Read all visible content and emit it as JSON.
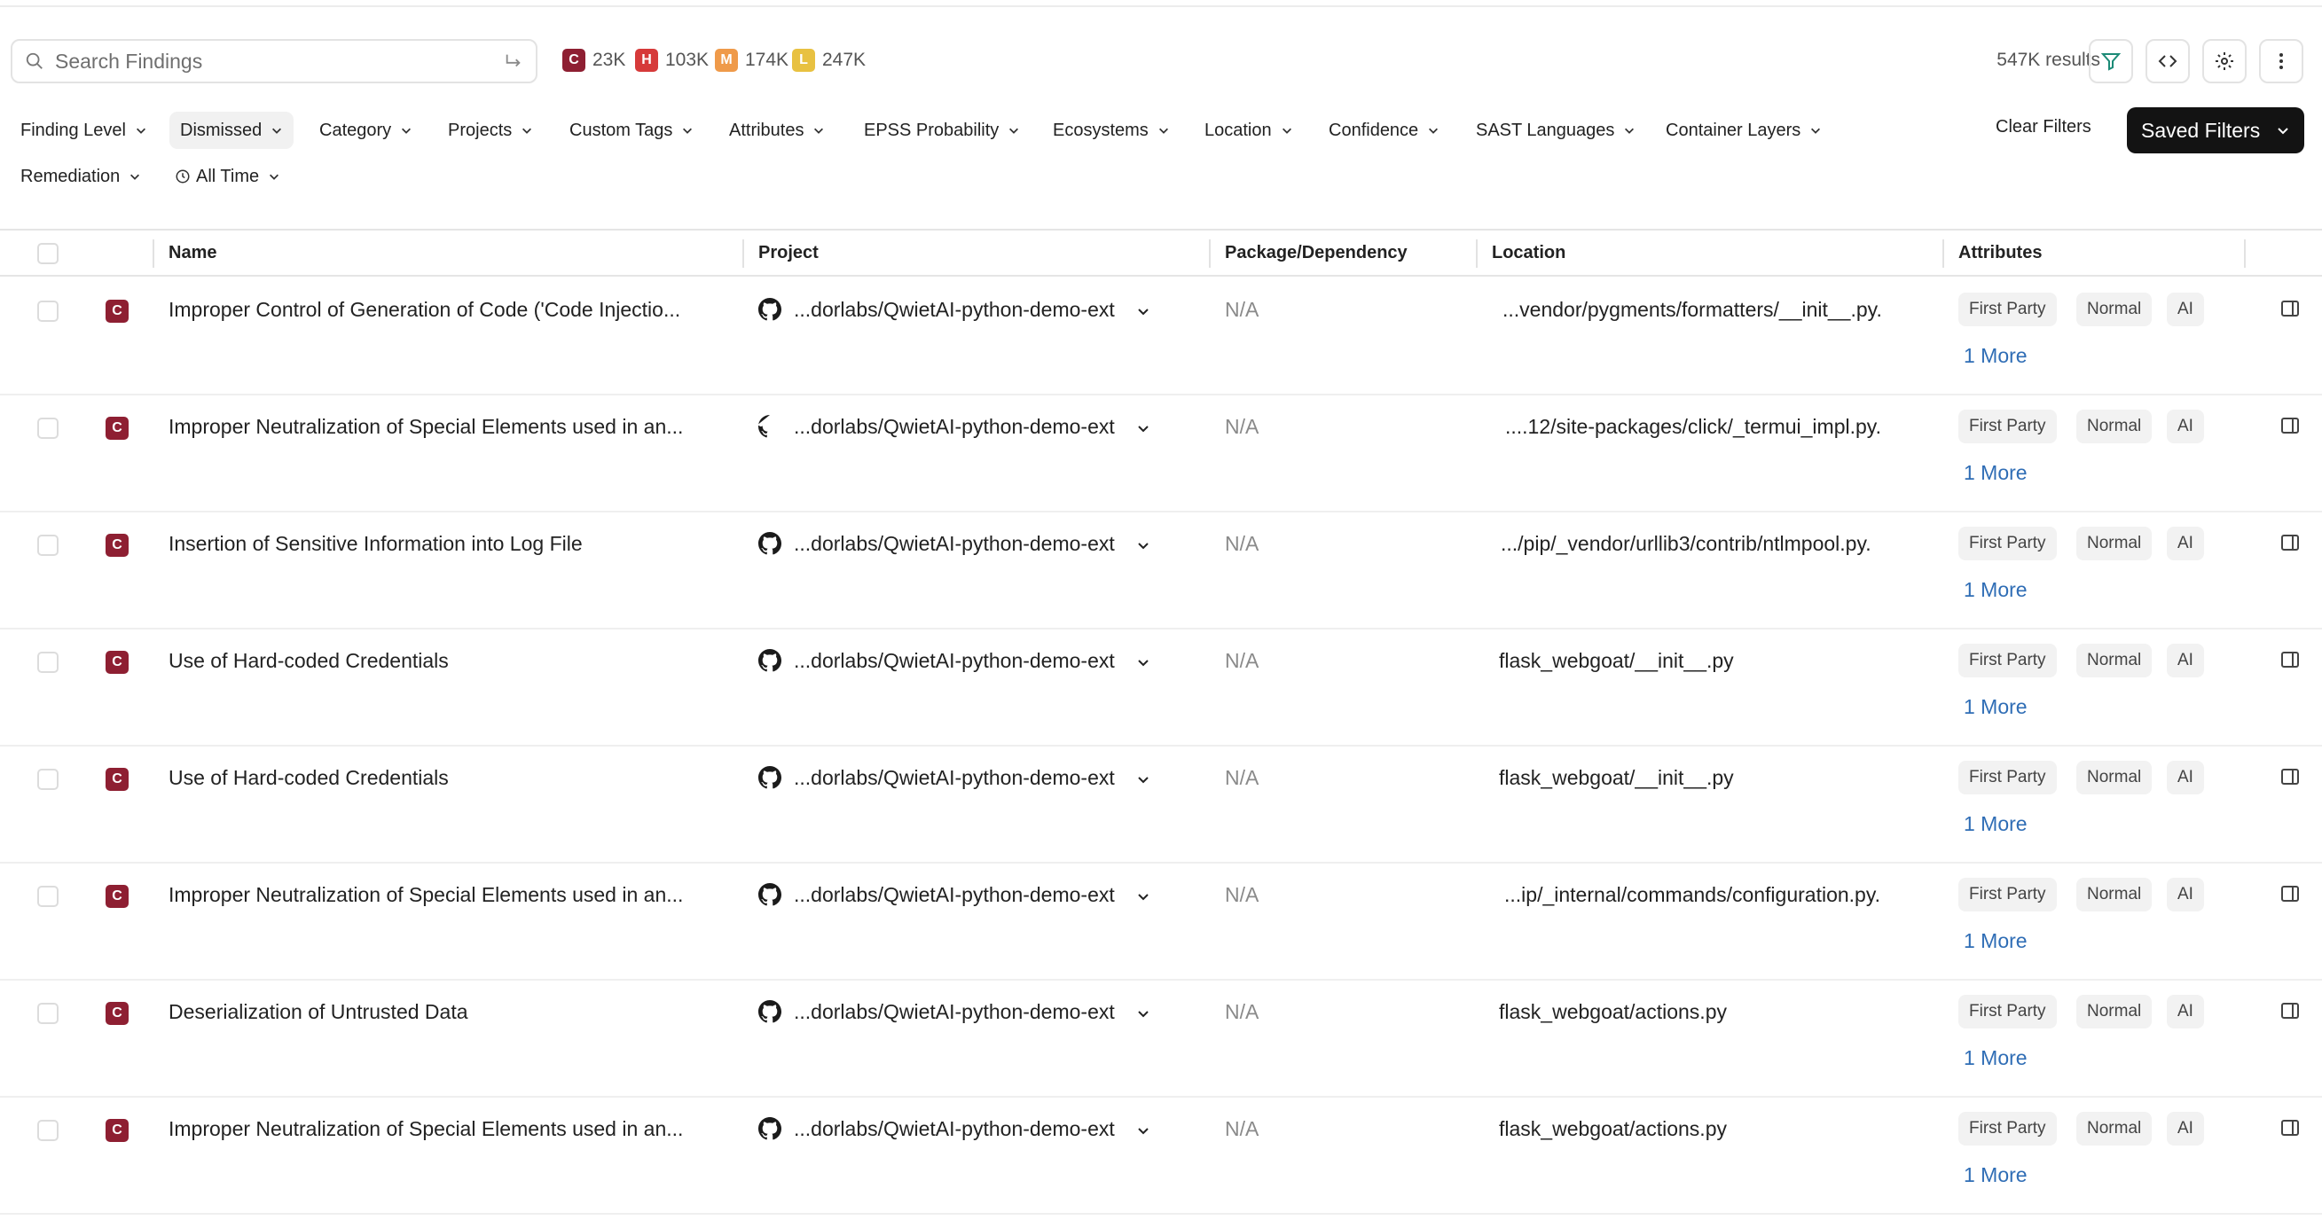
{
  "search": {
    "placeholder": "Search Findings"
  },
  "severity_counts": [
    {
      "letter": "C",
      "count": "23K",
      "color": "#8e1f32"
    },
    {
      "letter": "H",
      "count": "103K",
      "color": "#d63a3a"
    },
    {
      "letter": "M",
      "count": "174K",
      "color": "#ef9a4a"
    },
    {
      "letter": "L",
      "count": "247K",
      "color": "#e8c141"
    }
  ],
  "results_text": "547K results",
  "toolbar_icons": [
    "filter-icon",
    "code-icon",
    "gear-icon",
    "more-vertical-icon"
  ],
  "filters": [
    {
      "label": "Finding Level",
      "active": false
    },
    {
      "label": "Dismissed",
      "active": true
    },
    {
      "label": "Category",
      "active": false
    },
    {
      "label": "Projects",
      "active": false
    },
    {
      "label": "Custom Tags",
      "active": false
    },
    {
      "label": "Attributes",
      "active": false
    },
    {
      "label": "EPSS Probability",
      "active": false
    },
    {
      "label": "Ecosystems",
      "active": false
    },
    {
      "label": "Location",
      "active": false
    },
    {
      "label": "Confidence",
      "active": false
    },
    {
      "label": "SAST Languages",
      "active": false
    },
    {
      "label": "Container Layers",
      "active": false
    },
    {
      "label": "Remediation",
      "active": false
    },
    {
      "label": "All Time",
      "active": false
    }
  ],
  "clear_filters_label": "Clear Filters",
  "saved_filters_label": "Saved Filters",
  "columns": [
    "Name",
    "Project",
    "Package/Dependency",
    "Location",
    "Attributes"
  ],
  "rows": [
    {
      "severity": "C",
      "name": "Improper Control of Generation of Code ('Code Injectio...",
      "project": "...dorlabs/QwietAI-python-demo-ext",
      "package": "N/A",
      "location": "...vendor/pygments/formatters/__init__.py.",
      "attributes": [
        "First Party",
        "Normal",
        "AI"
      ],
      "more": "1 More"
    },
    {
      "severity": "C",
      "name": "Improper Neutralization of Special Elements used in an...",
      "project": "...dorlabs/QwietAI-python-demo-ext",
      "package": "N/A",
      "location": "....12/site-packages/click/_termui_impl.py.",
      "attributes": [
        "First Party",
        "Normal",
        "AI"
      ],
      "more": "1 More"
    },
    {
      "severity": "C",
      "name": "Insertion of Sensitive Information into Log File",
      "project": "...dorlabs/QwietAI-python-demo-ext",
      "package": "N/A",
      "location": ".../pip/_vendor/urllib3/contrib/ntlmpool.py.",
      "attributes": [
        "First Party",
        "Normal",
        "AI"
      ],
      "more": "1 More"
    },
    {
      "severity": "C",
      "name": "Use of Hard-coded Credentials",
      "project": "...dorlabs/QwietAI-python-demo-ext",
      "package": "N/A",
      "location": "flask_webgoat/__init__.py",
      "attributes": [
        "First Party",
        "Normal",
        "AI"
      ],
      "more": "1 More"
    },
    {
      "severity": "C",
      "name": "Use of Hard-coded Credentials",
      "project": "...dorlabs/QwietAI-python-demo-ext",
      "package": "N/A",
      "location": "flask_webgoat/__init__.py",
      "attributes": [
        "First Party",
        "Normal",
        "AI"
      ],
      "more": "1 More"
    },
    {
      "severity": "C",
      "name": "Improper Neutralization of Special Elements used in an...",
      "project": "...dorlabs/QwietAI-python-demo-ext",
      "package": "N/A",
      "location": "...ip/_internal/commands/configuration.py.",
      "attributes": [
        "First Party",
        "Normal",
        "AI"
      ],
      "more": "1 More"
    },
    {
      "severity": "C",
      "name": "Deserialization of Untrusted Data",
      "project": "...dorlabs/QwietAI-python-demo-ext",
      "package": "N/A",
      "location": "flask_webgoat/actions.py",
      "attributes": [
        "First Party",
        "Normal",
        "AI"
      ],
      "more": "1 More"
    },
    {
      "severity": "C",
      "name": "Improper Neutralization of Special Elements used in an...",
      "project": "...dorlabs/QwietAI-python-demo-ext",
      "package": "N/A",
      "location": "flask_webgoat/actions.py",
      "attributes": [
        "First Party",
        "Normal",
        "AI"
      ],
      "more": "1 More"
    }
  ]
}
